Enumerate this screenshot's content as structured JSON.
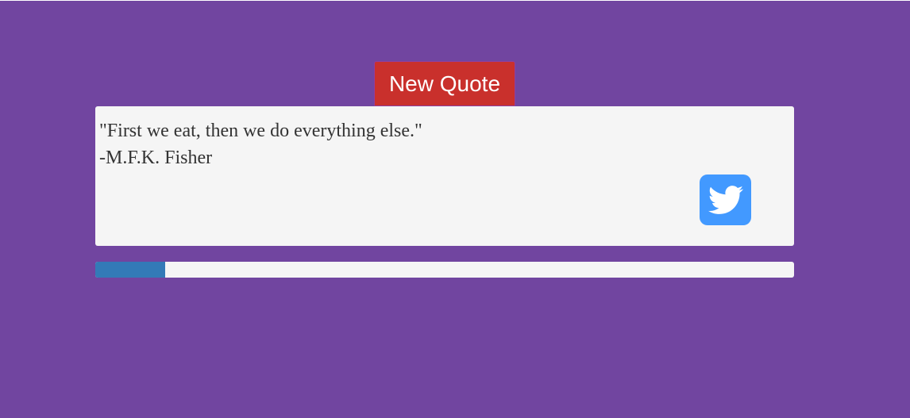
{
  "colors": {
    "page_background": "#7145A0",
    "new_quote_button": "#C9302C",
    "card_background": "#F5F5F5",
    "tweet_button": "#4299FF",
    "progress_fill": "#337AB7",
    "text": "#333333"
  },
  "toolbar": {
    "new_quote_label": "New Quote"
  },
  "quote": {
    "text": "\"First we eat, then we do everything else.\"",
    "author": "-M.F.K. Fisher"
  },
  "share": {
    "icon": "twitter-icon"
  },
  "progress": {
    "fraction": 0.1
  }
}
